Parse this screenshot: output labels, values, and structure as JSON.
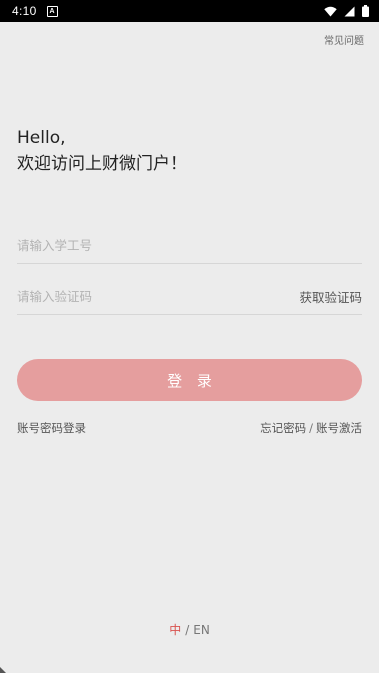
{
  "status_bar": {
    "time": "4:10",
    "notification_icon": "A",
    "icons": [
      "wifi-icon",
      "signal-icon",
      "battery-icon"
    ]
  },
  "header": {
    "faq_label": "常见问题"
  },
  "greeting": {
    "line1": "Hello,",
    "line2": "欢迎访问上财微门户！"
  },
  "form": {
    "student_id_placeholder": "请输入学工号",
    "code_placeholder": "请输入验证码",
    "get_code_label": "获取验证码",
    "login_label": "登 录"
  },
  "links": {
    "password_login": "账号密码登录",
    "forgot_password": "忘记密码",
    "separator": "/",
    "activate_account": "账号激活"
  },
  "language": {
    "zh": "中",
    "separator": "/",
    "en": "EN"
  },
  "colors": {
    "accent": "#e59e9e",
    "active_language": "#d9534f",
    "background": "#ececec"
  }
}
